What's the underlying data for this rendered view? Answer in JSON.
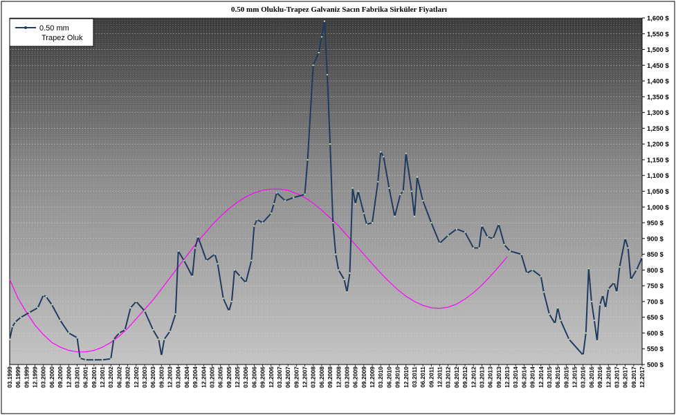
{
  "chart_data": {
    "type": "line",
    "title": "0.50  mm  Oluklu-Trapez  Galvaniz  Sacın Fabrika  Sirküler  Fiyatları",
    "ylim": [
      500,
      1600
    ],
    "y_ticks": [
      "500 $",
      "550 $",
      "600 $",
      "650 $",
      "700 $",
      "750 $",
      "800 $",
      "850 $",
      "900 $",
      "950 $",
      "1,000 $",
      "1,050 $",
      "1,100 $",
      "1,150 $",
      "1,200 $",
      "1,250 $",
      "1,300 $",
      "1,350 $",
      "1,400 $",
      "1,450 $",
      "1,500 $",
      "1,550 $",
      "1,600 $"
    ],
    "x_ticks": [
      "03.1999",
      "06.1999",
      "09.1999",
      "12.1999",
      "03.2000",
      "06.2000",
      "09.2000",
      "12.2000",
      "03.2001",
      "06.2001",
      "09.2001",
      "12.2001",
      "03.2002",
      "06.2002",
      "09.2002",
      "12.2002",
      "03.2003",
      "06.2003",
      "09.2003",
      "12.2003",
      "03.2004",
      "06.2004",
      "09.2004",
      "12.2004",
      "03.2005",
      "06.2005",
      "09.2005",
      "12.2005",
      "03.2006",
      "06.2006",
      "09.2006",
      "12.2006",
      "03.2007",
      "06.2007",
      "09.2007",
      "12.2007",
      "03.2008",
      "06.2008",
      "09.2008",
      "12.2008",
      "03.2009",
      "06.2009",
      "09.2009",
      "12.2009",
      "03.2010",
      "06.2010",
      "09.2010",
      "12.2010",
      "03.2011",
      "06.2011",
      "09.2011",
      "12.2011",
      "03.2012",
      "06.2012",
      "09.2012",
      "12.2012",
      "03.2013",
      "06.2013",
      "09.2013",
      "12.2013",
      "03.2014",
      "06.2014",
      "09.2014",
      "12.2014",
      "03.2015",
      "06.2015",
      "09.2015",
      "12.2015",
      "03.2016",
      "06.2016",
      "09.2016",
      "12.2016",
      "03.2017",
      "06.2017",
      "09.2017",
      "12.2017"
    ],
    "grid": true,
    "legend": {
      "position": "top-left",
      "entries": [
        "0.50 mm",
        "Trapez Oluk"
      ]
    },
    "series": [
      {
        "name": "0.50 mm Trapez Oluk",
        "color": "#1f3a5f",
        "points": [
          [
            "03.1999",
            580
          ],
          [
            "04.1999",
            620
          ],
          [
            "05.1999",
            635
          ],
          [
            "07.1999",
            650
          ],
          [
            "10.1999",
            665
          ],
          [
            "01.2000",
            680
          ],
          [
            "03.2000",
            720
          ],
          [
            "04.2000",
            715
          ],
          [
            "06.2000",
            690
          ],
          [
            "09.2000",
            640
          ],
          [
            "12.2000",
            600
          ],
          [
            "03.2001",
            585
          ],
          [
            "04.2001",
            520
          ],
          [
            "06.2001",
            515
          ],
          [
            "09.2001",
            515
          ],
          [
            "12.2001",
            515
          ],
          [
            "03.2002",
            518
          ],
          [
            "04.2002",
            580
          ],
          [
            "06.2002",
            600
          ],
          [
            "08.2002",
            610
          ],
          [
            "10.2002",
            680
          ],
          [
            "12.2002",
            700
          ],
          [
            "03.2003",
            670
          ],
          [
            "06.2003",
            610
          ],
          [
            "08.2003",
            580
          ],
          [
            "09.2003",
            528
          ],
          [
            "10.2003",
            580
          ],
          [
            "12.2003",
            605
          ],
          [
            "02.2004",
            660
          ],
          [
            "03.2004",
            860
          ],
          [
            "05.2004",
            830
          ],
          [
            "08.2004",
            780
          ],
          [
            "09.2004",
            870
          ],
          [
            "10.2004",
            905
          ],
          [
            "01.2005",
            830
          ],
          [
            "04.2005",
            850
          ],
          [
            "05.2005",
            820
          ],
          [
            "07.2005",
            710
          ],
          [
            "09.2005",
            670
          ],
          [
            "10.2005",
            700
          ],
          [
            "11.2005",
            800
          ],
          [
            "01.2006",
            780
          ],
          [
            "03.2006",
            760
          ],
          [
            "05.2006",
            830
          ],
          [
            "06.2006",
            940
          ],
          [
            "07.2006",
            960
          ],
          [
            "09.2006",
            950
          ],
          [
            "12.2006",
            980
          ],
          [
            "01.2007",
            1010
          ],
          [
            "02.2007",
            1045
          ],
          [
            "05.2007",
            1020
          ],
          [
            "08.2007",
            1030
          ],
          [
            "12.2007",
            1040
          ],
          [
            "01.2008",
            1150
          ],
          [
            "03.2008",
            1450
          ],
          [
            "05.2008",
            1490
          ],
          [
            "06.2008",
            1540
          ],
          [
            "07.2008",
            1590
          ],
          [
            "08.2008",
            1420
          ],
          [
            "09.2008",
            1200
          ],
          [
            "10.2008",
            950
          ],
          [
            "11.2008",
            850
          ],
          [
            "12.2008",
            800
          ],
          [
            "02.2009",
            770
          ],
          [
            "03.2009",
            730
          ],
          [
            "04.2009",
            790
          ],
          [
            "05.2009",
            1060
          ],
          [
            "06.2009",
            1010
          ],
          [
            "07.2009",
            1050
          ],
          [
            "09.2009",
            980
          ],
          [
            "10.2009",
            945
          ],
          [
            "12.2009",
            950
          ],
          [
            "02.2010",
            1080
          ],
          [
            "03.2010",
            1175
          ],
          [
            "04.2010",
            1160
          ],
          [
            "06.2010",
            1060
          ],
          [
            "08.2010",
            970
          ],
          [
            "10.2010",
            1040
          ],
          [
            "11.2010",
            1050
          ],
          [
            "12.2010",
            1170
          ],
          [
            "02.2011",
            1050
          ],
          [
            "03.2011",
            970
          ],
          [
            "04.2011",
            1095
          ],
          [
            "06.2011",
            1020
          ],
          [
            "09.2011",
            950
          ],
          [
            "12.2011",
            885
          ],
          [
            "03.2012",
            910
          ],
          [
            "06.2012",
            930
          ],
          [
            "09.2012",
            920
          ],
          [
            "12.2012",
            870
          ],
          [
            "02.2013",
            870
          ],
          [
            "03.2013",
            940
          ],
          [
            "05.2013",
            905
          ],
          [
            "07.2013",
            900
          ],
          [
            "09.2013",
            945
          ],
          [
            "11.2013",
            880
          ],
          [
            "01.2014",
            860
          ],
          [
            "05.2014",
            850
          ],
          [
            "07.2014",
            790
          ],
          [
            "09.2014",
            800
          ],
          [
            "12.2014",
            780
          ],
          [
            "01.2015",
            730
          ],
          [
            "03.2015",
            660
          ],
          [
            "05.2015",
            630
          ],
          [
            "06.2015",
            680
          ],
          [
            "07.2015",
            640
          ],
          [
            "10.2015",
            580
          ],
          [
            "03.2016",
            530
          ],
          [
            "04.2016",
            600
          ],
          [
            "05.2016",
            805
          ],
          [
            "06.2016",
            700
          ],
          [
            "07.2016",
            640
          ],
          [
            "08.2016",
            575
          ],
          [
            "09.2016",
            690
          ],
          [
            "10.2016",
            720
          ],
          [
            "11.2016",
            680
          ],
          [
            "12.2016",
            740
          ],
          [
            "02.2017",
            760
          ],
          [
            "03.2017",
            730
          ],
          [
            "04.2017",
            810
          ],
          [
            "06.2017",
            900
          ],
          [
            "07.2017",
            870
          ],
          [
            "08.2017",
            770
          ],
          [
            "10.2017",
            800
          ],
          [
            "12.2017",
            840
          ]
        ]
      },
      {
        "name": "",
        "color": "#ff00ff",
        "points": [
          [
            "03.1999",
            770
          ],
          [
            "06.1999",
            710
          ],
          [
            "09.1999",
            665
          ],
          [
            "12.1999",
            625
          ],
          [
            "03.2000",
            595
          ],
          [
            "06.2000",
            570
          ],
          [
            "09.2000",
            555
          ],
          [
            "12.2000",
            545
          ],
          [
            "03.2001",
            540
          ],
          [
            "06.2001",
            540
          ],
          [
            "09.2001",
            545
          ],
          [
            "12.2001",
            555
          ],
          [
            "03.2002",
            570
          ],
          [
            "06.2002",
            590
          ],
          [
            "09.2002",
            615
          ],
          [
            "12.2002",
            645
          ],
          [
            "03.2003",
            675
          ],
          [
            "06.2003",
            705
          ],
          [
            "09.2003",
            740
          ],
          [
            "12.2003",
            775
          ],
          [
            "03.2004",
            810
          ],
          [
            "06.2004",
            845
          ],
          [
            "09.2004",
            880
          ],
          [
            "12.2004",
            912
          ],
          [
            "03.2005",
            943
          ],
          [
            "06.2005",
            970
          ],
          [
            "09.2005",
            995
          ],
          [
            "12.2005",
            1015
          ],
          [
            "03.2006",
            1032
          ],
          [
            "06.2006",
            1045
          ],
          [
            "09.2006",
            1053
          ],
          [
            "12.2006",
            1057
          ],
          [
            "03.2007",
            1057
          ],
          [
            "06.2007",
            1053
          ],
          [
            "09.2007",
            1043
          ],
          [
            "12.2007",
            1030
          ],
          [
            "03.2008",
            1012
          ],
          [
            "06.2008",
            990
          ],
          [
            "09.2008",
            966
          ],
          [
            "12.2008",
            940
          ],
          [
            "03.2009",
            910
          ],
          [
            "06.2009",
            880
          ],
          [
            "09.2009",
            850
          ],
          [
            "12.2009",
            820
          ],
          [
            "03.2010",
            790
          ],
          [
            "06.2010",
            763
          ],
          [
            "09.2010",
            738
          ],
          [
            "12.2010",
            717
          ],
          [
            "03.2011",
            700
          ],
          [
            "06.2011",
            688
          ],
          [
            "09.2011",
            680
          ],
          [
            "12.2011",
            678
          ],
          [
            "03.2012",
            682
          ],
          [
            "06.2012",
            692
          ],
          [
            "09.2012",
            708
          ],
          [
            "12.2012",
            728
          ],
          [
            "03.2013",
            752
          ],
          [
            "06.2013",
            780
          ],
          [
            "09.2013",
            810
          ],
          [
            "12.2013",
            842
          ]
        ]
      }
    ]
  }
}
